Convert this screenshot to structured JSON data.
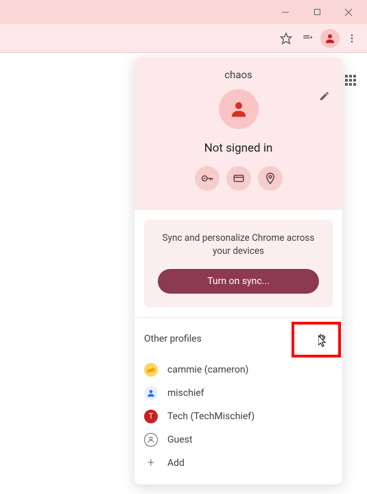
{
  "profile": {
    "name": "chaos",
    "status": "Not signed in"
  },
  "sync": {
    "message": "Sync and personalize Chrome across your devices",
    "button": "Turn on sync..."
  },
  "otherProfilesTitle": "Other profiles",
  "profiles": [
    {
      "label": "cammie (cameron)"
    },
    {
      "label": "mischief"
    },
    {
      "label": "Tech (TechMischief)"
    },
    {
      "label": "Guest"
    },
    {
      "label": "Add"
    }
  ],
  "colors": {
    "accentBg": "#fde9e9",
    "syncBtn": "#8b3a50"
  }
}
